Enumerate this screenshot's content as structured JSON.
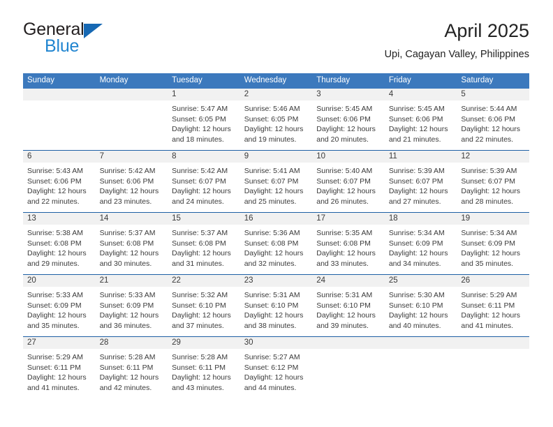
{
  "brand": {
    "name_part1": "General",
    "name_part2": "Blue",
    "triangle_color": "#1668b3",
    "blue_color": "#2185d0",
    "dark_color": "#231f20"
  },
  "header": {
    "title": "April 2025",
    "subtitle": "Upi, Cagayan Valley, Philippines"
  },
  "theme": {
    "header_bg": "#3c79bd",
    "header_text": "#ffffff",
    "row_divider": "#1d5fa4",
    "daynum_bg": "#f1f1f1",
    "body_text": "#3a3a3a"
  },
  "weekday_headers": [
    "Sunday",
    "Monday",
    "Tuesday",
    "Wednesday",
    "Thursday",
    "Friday",
    "Saturday"
  ],
  "weeks": [
    [
      {
        "day": "",
        "empty": true
      },
      {
        "day": "",
        "empty": true
      },
      {
        "day": "1",
        "sunrise": "Sunrise: 5:47 AM",
        "sunset": "Sunset: 6:05 PM",
        "daylight": "Daylight: 12 hours and 18 minutes."
      },
      {
        "day": "2",
        "sunrise": "Sunrise: 5:46 AM",
        "sunset": "Sunset: 6:05 PM",
        "daylight": "Daylight: 12 hours and 19 minutes."
      },
      {
        "day": "3",
        "sunrise": "Sunrise: 5:45 AM",
        "sunset": "Sunset: 6:06 PM",
        "daylight": "Daylight: 12 hours and 20 minutes."
      },
      {
        "day": "4",
        "sunrise": "Sunrise: 5:45 AM",
        "sunset": "Sunset: 6:06 PM",
        "daylight": "Daylight: 12 hours and 21 minutes."
      },
      {
        "day": "5",
        "sunrise": "Sunrise: 5:44 AM",
        "sunset": "Sunset: 6:06 PM",
        "daylight": "Daylight: 12 hours and 22 minutes."
      }
    ],
    [
      {
        "day": "6",
        "sunrise": "Sunrise: 5:43 AM",
        "sunset": "Sunset: 6:06 PM",
        "daylight": "Daylight: 12 hours and 22 minutes."
      },
      {
        "day": "7",
        "sunrise": "Sunrise: 5:42 AM",
        "sunset": "Sunset: 6:06 PM",
        "daylight": "Daylight: 12 hours and 23 minutes."
      },
      {
        "day": "8",
        "sunrise": "Sunrise: 5:42 AM",
        "sunset": "Sunset: 6:07 PM",
        "daylight": "Daylight: 12 hours and 24 minutes."
      },
      {
        "day": "9",
        "sunrise": "Sunrise: 5:41 AM",
        "sunset": "Sunset: 6:07 PM",
        "daylight": "Daylight: 12 hours and 25 minutes."
      },
      {
        "day": "10",
        "sunrise": "Sunrise: 5:40 AM",
        "sunset": "Sunset: 6:07 PM",
        "daylight": "Daylight: 12 hours and 26 minutes."
      },
      {
        "day": "11",
        "sunrise": "Sunrise: 5:39 AM",
        "sunset": "Sunset: 6:07 PM",
        "daylight": "Daylight: 12 hours and 27 minutes."
      },
      {
        "day": "12",
        "sunrise": "Sunrise: 5:39 AM",
        "sunset": "Sunset: 6:07 PM",
        "daylight": "Daylight: 12 hours and 28 minutes."
      }
    ],
    [
      {
        "day": "13",
        "sunrise": "Sunrise: 5:38 AM",
        "sunset": "Sunset: 6:08 PM",
        "daylight": "Daylight: 12 hours and 29 minutes."
      },
      {
        "day": "14",
        "sunrise": "Sunrise: 5:37 AM",
        "sunset": "Sunset: 6:08 PM",
        "daylight": "Daylight: 12 hours and 30 minutes."
      },
      {
        "day": "15",
        "sunrise": "Sunrise: 5:37 AM",
        "sunset": "Sunset: 6:08 PM",
        "daylight": "Daylight: 12 hours and 31 minutes."
      },
      {
        "day": "16",
        "sunrise": "Sunrise: 5:36 AM",
        "sunset": "Sunset: 6:08 PM",
        "daylight": "Daylight: 12 hours and 32 minutes."
      },
      {
        "day": "17",
        "sunrise": "Sunrise: 5:35 AM",
        "sunset": "Sunset: 6:08 PM",
        "daylight": "Daylight: 12 hours and 33 minutes."
      },
      {
        "day": "18",
        "sunrise": "Sunrise: 5:34 AM",
        "sunset": "Sunset: 6:09 PM",
        "daylight": "Daylight: 12 hours and 34 minutes."
      },
      {
        "day": "19",
        "sunrise": "Sunrise: 5:34 AM",
        "sunset": "Sunset: 6:09 PM",
        "daylight": "Daylight: 12 hours and 35 minutes."
      }
    ],
    [
      {
        "day": "20",
        "sunrise": "Sunrise: 5:33 AM",
        "sunset": "Sunset: 6:09 PM",
        "daylight": "Daylight: 12 hours and 35 minutes."
      },
      {
        "day": "21",
        "sunrise": "Sunrise: 5:33 AM",
        "sunset": "Sunset: 6:09 PM",
        "daylight": "Daylight: 12 hours and 36 minutes."
      },
      {
        "day": "22",
        "sunrise": "Sunrise: 5:32 AM",
        "sunset": "Sunset: 6:10 PM",
        "daylight": "Daylight: 12 hours and 37 minutes."
      },
      {
        "day": "23",
        "sunrise": "Sunrise: 5:31 AM",
        "sunset": "Sunset: 6:10 PM",
        "daylight": "Daylight: 12 hours and 38 minutes."
      },
      {
        "day": "24",
        "sunrise": "Sunrise: 5:31 AM",
        "sunset": "Sunset: 6:10 PM",
        "daylight": "Daylight: 12 hours and 39 minutes."
      },
      {
        "day": "25",
        "sunrise": "Sunrise: 5:30 AM",
        "sunset": "Sunset: 6:10 PM",
        "daylight": "Daylight: 12 hours and 40 minutes."
      },
      {
        "day": "26",
        "sunrise": "Sunrise: 5:29 AM",
        "sunset": "Sunset: 6:11 PM",
        "daylight": "Daylight: 12 hours and 41 minutes."
      }
    ],
    [
      {
        "day": "27",
        "sunrise": "Sunrise: 5:29 AM",
        "sunset": "Sunset: 6:11 PM",
        "daylight": "Daylight: 12 hours and 41 minutes."
      },
      {
        "day": "28",
        "sunrise": "Sunrise: 5:28 AM",
        "sunset": "Sunset: 6:11 PM",
        "daylight": "Daylight: 12 hours and 42 minutes."
      },
      {
        "day": "29",
        "sunrise": "Sunrise: 5:28 AM",
        "sunset": "Sunset: 6:11 PM",
        "daylight": "Daylight: 12 hours and 43 minutes."
      },
      {
        "day": "30",
        "sunrise": "Sunrise: 5:27 AM",
        "sunset": "Sunset: 6:12 PM",
        "daylight": "Daylight: 12 hours and 44 minutes."
      },
      {
        "day": "",
        "empty": true
      },
      {
        "day": "",
        "empty": true
      },
      {
        "day": "",
        "empty": true
      }
    ]
  ]
}
